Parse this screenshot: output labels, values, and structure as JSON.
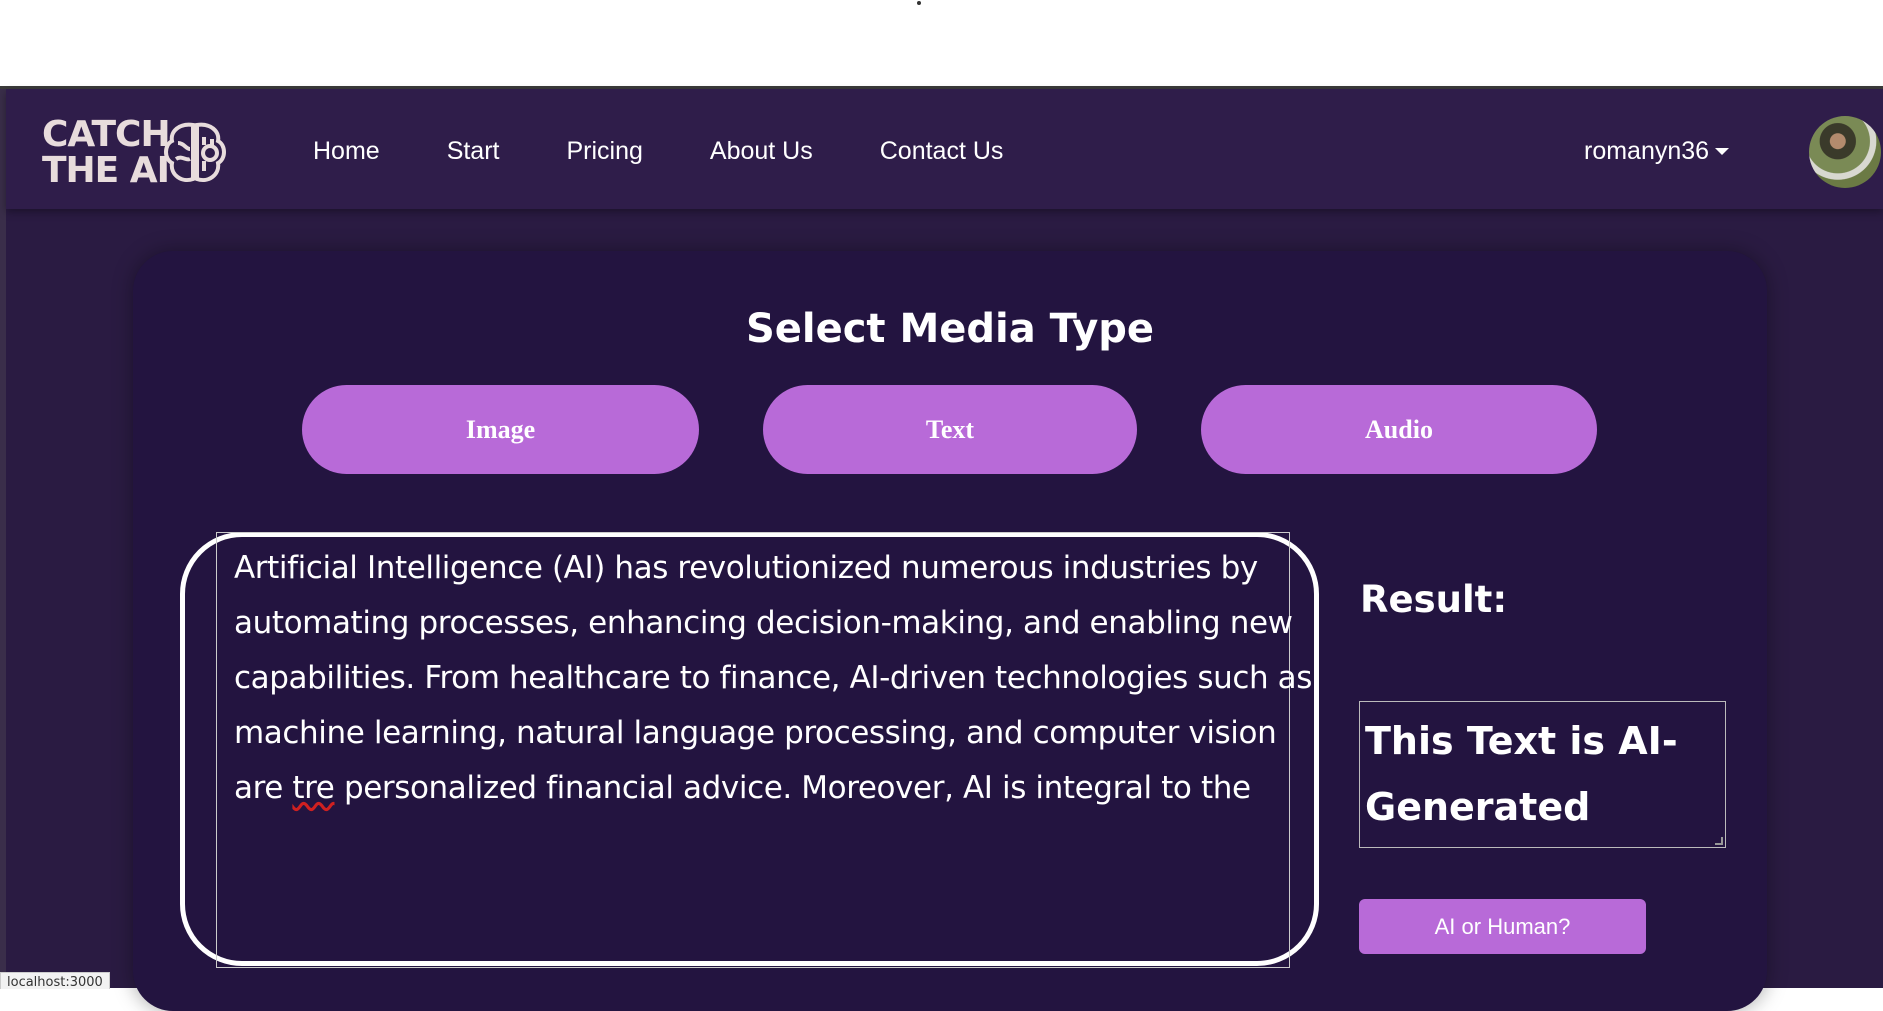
{
  "logo": {
    "line1": "CATCH",
    "line2": "THE AI"
  },
  "nav": {
    "links": [
      "Home",
      "Start",
      "Pricing",
      "About Us",
      "Contact Us"
    ],
    "user": "romanyn36"
  },
  "main": {
    "title": "Select Media Type",
    "media_types": [
      "Image",
      "Text",
      "Audio"
    ],
    "input_text_lines": [
      "Artificial Intelligence (AI) has revolutionized numerous industries by",
      "automating processes, enhancing decision-making, and enabling new",
      "capabilities. From healthcare to finance, AI-driven technologies such as",
      "machine learning, natural language processing, and computer vision"
    ],
    "input_line5": {
      "before": "are ",
      "misspelled": "tre",
      "after": " personalized financial advice. Moreover, AI is integral to the"
    },
    "result_label": "Result:",
    "result_text": "This Text is AI-Generated",
    "check_button": "AI or Human?"
  },
  "status_bar": "localhost:3000",
  "colors": {
    "background": "#2a1b42",
    "navbar": "#2f1d4a",
    "card": "#231440",
    "accent": "#b86ad8"
  }
}
